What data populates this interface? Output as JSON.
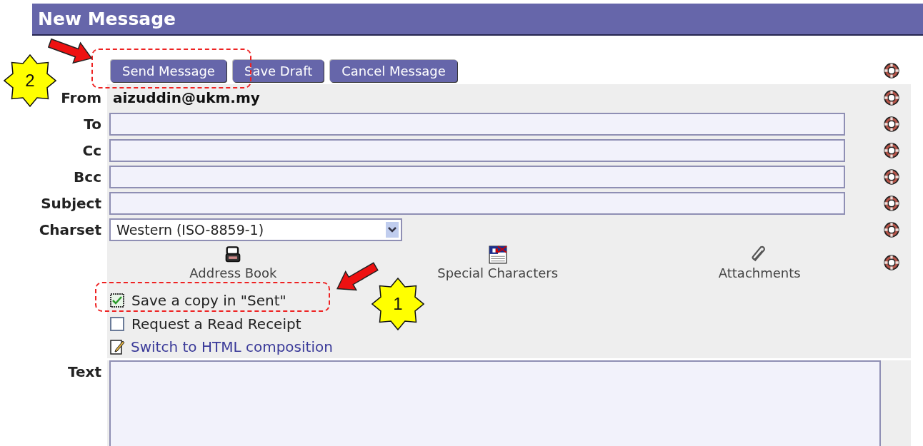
{
  "window": {
    "title": "New Message"
  },
  "buttons": [
    {
      "label": "Send Message"
    },
    {
      "label": "Save Draft"
    },
    {
      "label": "Cancel Message"
    }
  ],
  "from": {
    "label": "From",
    "value": "aizuddin@ukm.my"
  },
  "fields": [
    {
      "label": "To"
    },
    {
      "label": "Cc"
    },
    {
      "label": "Bcc"
    },
    {
      "label": "Subject"
    }
  ],
  "charset": {
    "label": "Charset",
    "value": "Western (ISO-8859-1)"
  },
  "tools": [
    {
      "kind": "address_book",
      "label": "Address Book"
    },
    {
      "kind": "special_characters",
      "label": "Special Characters"
    },
    {
      "kind": "attachments",
      "label": "Attachments"
    }
  ],
  "options": [
    {
      "label": "Save a copy in \"Sent\"",
      "checked": true
    },
    {
      "label": "Request a Read Receipt",
      "checked": false
    }
  ],
  "html_link": "Switch to HTML composition",
  "text_label": "Text",
  "annotations": [
    {
      "number": "2"
    },
    {
      "number": "1"
    }
  ]
}
